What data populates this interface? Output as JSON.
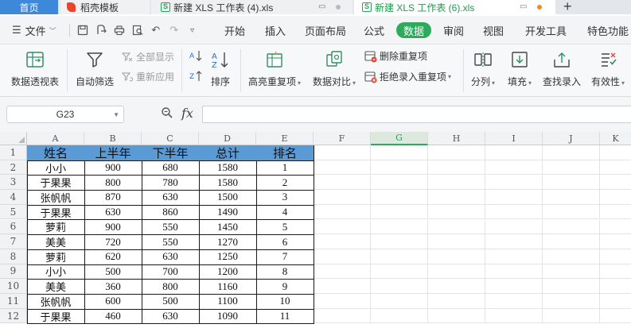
{
  "tabs": {
    "home": "首页",
    "template": "稻壳模板",
    "doc1": "新建 XLS 工作表 (4).xls",
    "doc2": "新建 XLS 工作表 (6).xls",
    "new_tab": "+"
  },
  "menu": {
    "file": "文件",
    "tabs": [
      "开始",
      "插入",
      "页面布局",
      "公式",
      "数据",
      "审阅",
      "视图",
      "开发工具",
      "特色功能"
    ],
    "active_tab": "数据"
  },
  "ribbon": {
    "pivot": "数据透视表",
    "autofilter": "自动筛选",
    "show_all": "全部显示",
    "reapply": "重新应用",
    "sort": "排序",
    "highlight_dup": "高亮重复项",
    "compare": "数据对比",
    "remove_dup": "删除重复项",
    "reject_dup": "拒绝录入重复项",
    "split": "分列",
    "fill": "填充",
    "lookup_entry": "查找录入",
    "validity": "有效性"
  },
  "formula_bar": {
    "name_box": "G23",
    "fx": "fx",
    "formula": ""
  },
  "sheet": {
    "columns": [
      "A",
      "B",
      "C",
      "D",
      "E",
      "F",
      "G",
      "H",
      "I",
      "J",
      "K"
    ],
    "selected_column": "G",
    "rows": [
      "1",
      "2",
      "3",
      "4",
      "5",
      "6",
      "7",
      "8",
      "9",
      "10",
      "11",
      "12"
    ],
    "table_header": [
      "姓名",
      "上半年",
      "下半年",
      "总计",
      "排名"
    ],
    "table_rows": [
      [
        "小小",
        "900",
        "680",
        "1580",
        "1"
      ],
      [
        "于果果",
        "800",
        "780",
        "1580",
        "2"
      ],
      [
        "张帆帆",
        "870",
        "630",
        "1500",
        "3"
      ],
      [
        "于果果",
        "630",
        "860",
        "1490",
        "4"
      ],
      [
        "萝莉",
        "900",
        "550",
        "1450",
        "5"
      ],
      [
        "美美",
        "720",
        "550",
        "1270",
        "6"
      ],
      [
        "萝莉",
        "620",
        "630",
        "1250",
        "7"
      ],
      [
        "小小",
        "500",
        "700",
        "1200",
        "8"
      ],
      [
        "美美",
        "360",
        "800",
        "1160",
        "9"
      ],
      [
        "张帆帆",
        "600",
        "500",
        "1100",
        "10"
      ],
      [
        "于果果",
        "460",
        "630",
        "1090",
        "11"
      ]
    ]
  },
  "colors": {
    "accent": "#2faa5d",
    "header_fill": "#5b9bd5",
    "home_tab": "#3d88d8"
  }
}
